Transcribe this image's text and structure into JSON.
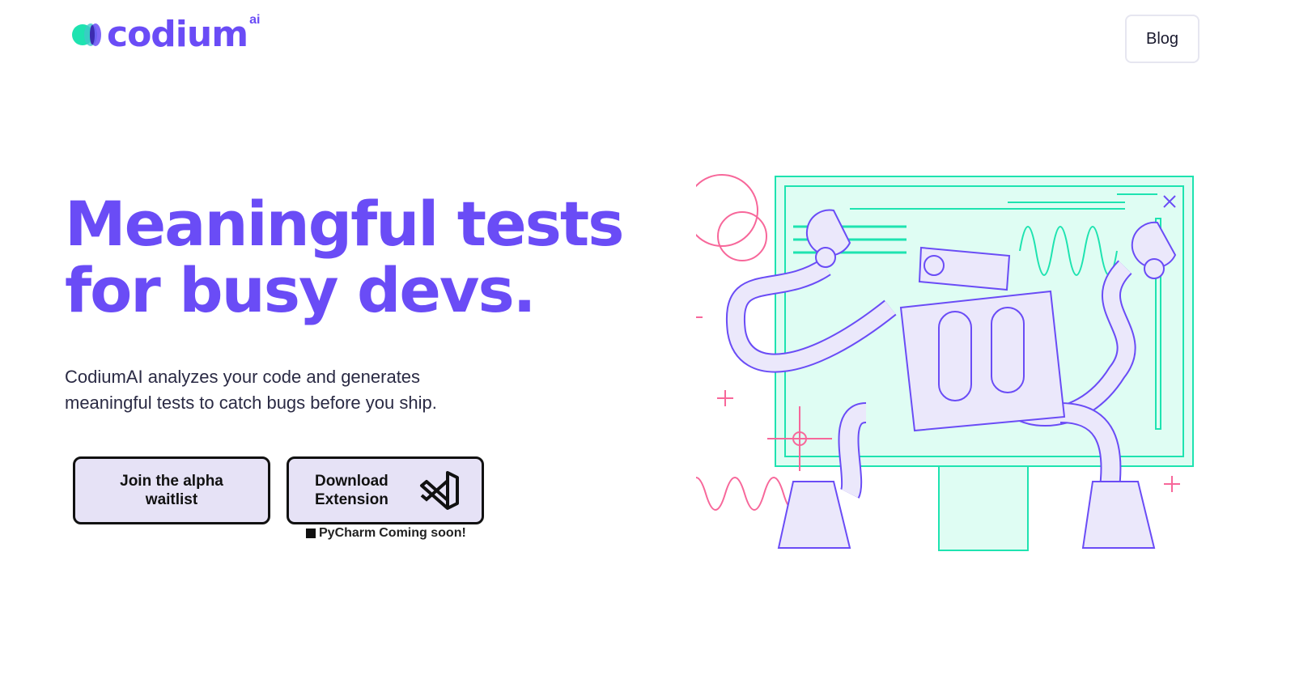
{
  "header": {
    "logo_text": "codium",
    "logo_suffix": "ai",
    "blog_label": "Blog"
  },
  "hero": {
    "title_line1": "Meaningful tests",
    "title_line2": "for busy devs.",
    "subtitle": "CodiumAI analyzes your code and generates meaningful tests to catch bugs before you ship."
  },
  "actions": {
    "waitlist_label": "Join the alpha waitlist",
    "download_label_1": "Download",
    "download_label_2": "Extension",
    "download_icon": "vscode-icon",
    "pycharm_label": "PyCharm",
    "coming_soon": "Coming soon!"
  },
  "colors": {
    "brand": "#6a4cf6",
    "accent_teal": "#1ee3b0",
    "accent_pink": "#f7679a",
    "button_bg": "#e6e2f6"
  }
}
